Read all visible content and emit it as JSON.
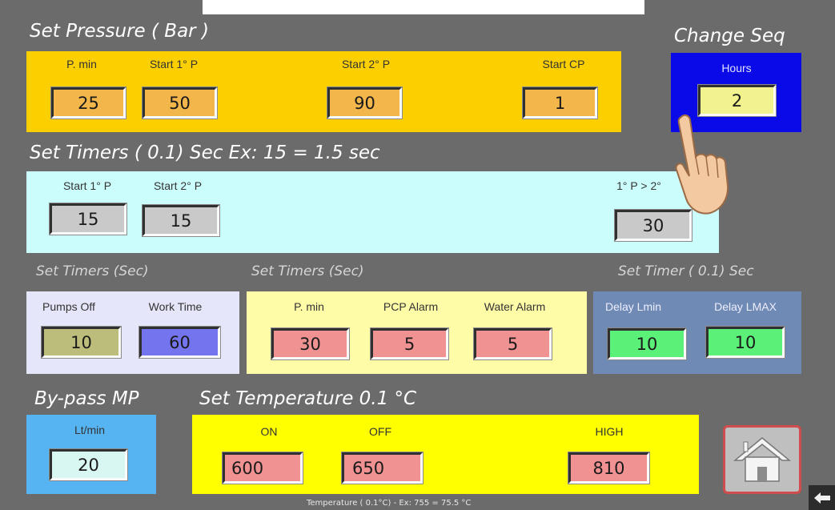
{
  "colors": {
    "background": "#6b6b6b",
    "pressure_panel": "#fbcf00",
    "hours_panel": "#0a0ae8",
    "timers_panel": "#ccfdfd",
    "pumps_panel": "#e6e6fa",
    "alarms_panel": "#fffca8",
    "delay_panel": "#6f8ab5",
    "bypass_panel": "#56b4f2",
    "temperature_panel": "#ffff00",
    "home_border": "#d14c4c"
  },
  "pressure": {
    "heading": "Set Pressure ( Bar )",
    "fields": [
      {
        "label": "P. min",
        "value": "25"
      },
      {
        "label": "Start  1° P",
        "value": "50"
      },
      {
        "label": "Start 2° P",
        "value": "90"
      },
      {
        "label": "Start CP",
        "value": "1"
      }
    ]
  },
  "change_seq": {
    "heading": "Change Seq",
    "label": "Hours",
    "value": "2"
  },
  "timers01": {
    "heading": "Set Timers ( 0.1) Sec   Ex: 15 = 1.5 sec",
    "fields": [
      {
        "label": "Start  1° P",
        "value": "15"
      },
      {
        "label": "Start 2° P",
        "value": "15"
      },
      {
        "label": "1° P > 2°",
        "value": "30"
      }
    ]
  },
  "timers_sec_a": {
    "heading": "Set Timers (Sec)",
    "fields": [
      {
        "label": "Pumps Off",
        "value": "10"
      },
      {
        "label": "Work Time",
        "value": "60"
      }
    ]
  },
  "timers_sec_b": {
    "heading": "Set Timers (Sec)",
    "fields": [
      {
        "label": "P. min",
        "value": "30"
      },
      {
        "label": "PCP Alarm",
        "value": "5"
      },
      {
        "label": "Water Alarm",
        "value": "5"
      }
    ]
  },
  "delay": {
    "heading": "Set Timer ( 0.1) Sec",
    "fields": [
      {
        "label": "Delay Lmin",
        "value": "10"
      },
      {
        "label": "Delay LMAX",
        "value": "10"
      }
    ]
  },
  "bypass": {
    "heading": "By-pass MP",
    "label": "Lt/min",
    "value": "20"
  },
  "temperature": {
    "heading": "Set Temperature  0.1 °C",
    "fields": [
      {
        "label": "ON",
        "value": "600"
      },
      {
        "label": "OFF",
        "value": "650"
      },
      {
        "label": "HIGH",
        "value": "810"
      }
    ],
    "footnote": "Temperature ( 0.1°C) - Ex: 755 = 75.5 °C"
  },
  "icons": {
    "home": "home-icon",
    "back": "back-arrow-icon",
    "pointer": "pointing-hand-icon"
  }
}
